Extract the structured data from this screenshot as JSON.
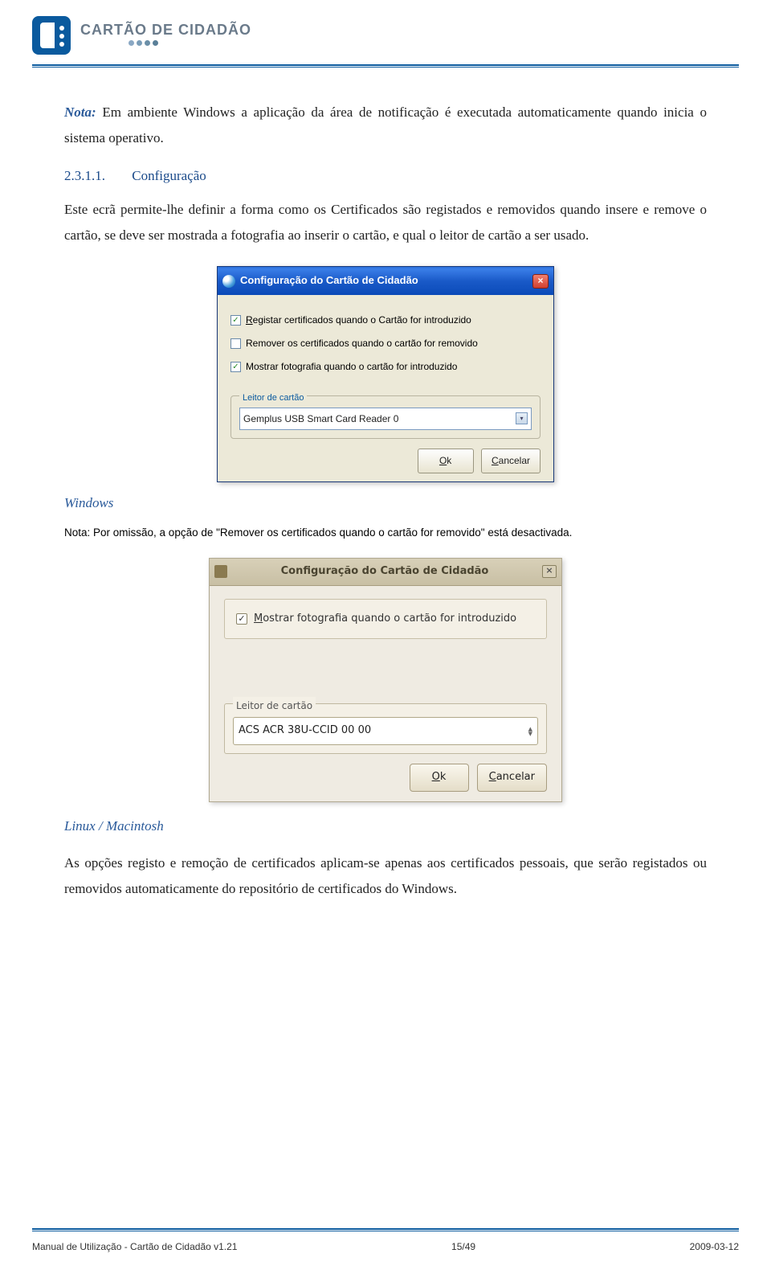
{
  "header": {
    "brand": "CARTÃO DE CIDADÃO"
  },
  "intro": {
    "nota_label": "Nota:",
    "nota_text": " Em ambiente Windows a aplicação da área de notificação é executada automaticamente quando inicia o sistema operativo."
  },
  "section": {
    "number": "2.3.1.1.",
    "title": "Configuração",
    "body": "Este ecrã permite-lhe definir a forma como os Certificados são registados e removidos quando insere e remove o cartão, se deve ser mostrada a fotografia ao inserir o cartão, e qual o leitor de cartão a ser usado."
  },
  "xp_dialog": {
    "title": "Configuração do Cartão de Cidadão",
    "checks": [
      {
        "label": "Registar certificados quando o Cartão for introduzido",
        "checked": true,
        "mnemonic": "R"
      },
      {
        "label": "Remover os certificados quando o cartão for removido",
        "checked": false,
        "mnemonic": ""
      },
      {
        "label": "Mostrar fotografia quando o cartão for introduzido",
        "checked": true,
        "mnemonic": ""
      }
    ],
    "reader_legend": "Leitor de cartão",
    "reader_value": "Gemplus USB Smart Card Reader 0",
    "ok": "Ok",
    "cancel": "Cancelar",
    "ok_u": "O",
    "cancel_u": "C"
  },
  "windows_label": "Windows",
  "windows_note": "Nota: Por omissão, a opção de \"Remover os certificados quando o cartão for removido\" está desactivada.",
  "gtk_dialog": {
    "title": "Configuração do Cartão de Cidadão",
    "check_label": "Mostrar fotografia quando o cartão for introduzido",
    "check_checked": true,
    "check_u": "M",
    "reader_legend": "Leitor de cartão",
    "reader_value": "ACS ACR 38U-CCID 00 00",
    "ok": "Ok",
    "cancel": "Cancelar",
    "ok_u": "O",
    "cancel_u": "C"
  },
  "linux_label": "Linux / Macintosh",
  "closing": "As opções registo e remoção de certificados aplicam-se apenas aos certificados pessoais, que serão registados ou removidos automaticamente do repositório de certificados do Windows.",
  "footer": {
    "left": "Manual de Utilização - Cartão de Cidadão v1.21",
    "page_cur": "15",
    "page_sep": "/",
    "page_total": "49",
    "right": "2009-03-12"
  }
}
